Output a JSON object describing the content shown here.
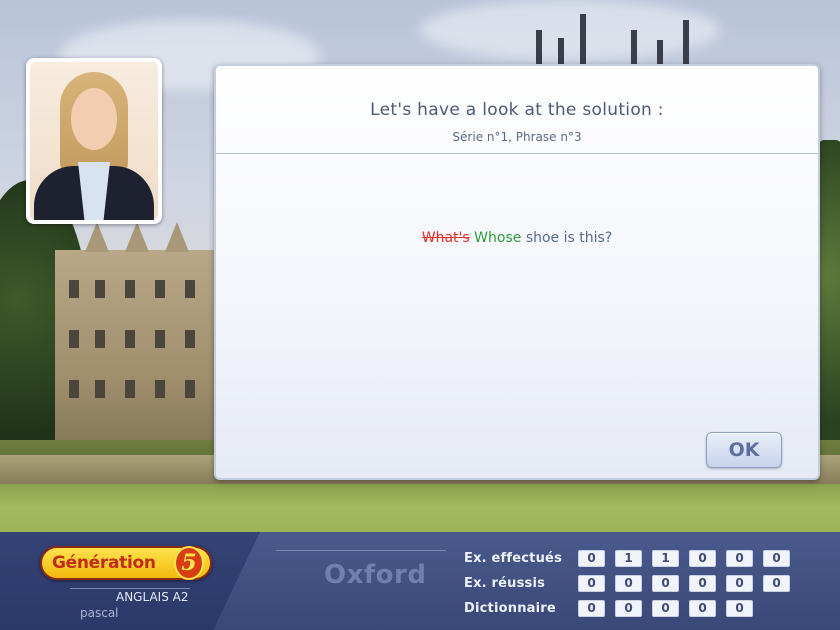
{
  "dialog": {
    "title": "Let's have a look at the solution :",
    "subtitle": "Série n°1, Phrase n°3",
    "sentence": {
      "wrong_word": "What's",
      "correct_word": "Whose",
      "rest": "shoe is this?"
    },
    "ok_label": "OK"
  },
  "brand": {
    "logo_text": "Génération",
    "logo_mark": "5",
    "course": "ANGLAIS A2",
    "user": "pascal",
    "city": "Oxford"
  },
  "stats": {
    "effectues": {
      "label": "Ex. effectués",
      "digits": [
        "0",
        "1",
        "1",
        "0",
        "0",
        "0"
      ]
    },
    "reussis": {
      "label": "Ex. réussis",
      "digits": [
        "0",
        "0",
        "0",
        "0",
        "0",
        "0"
      ]
    },
    "dictionnaire": {
      "label": "Dictionnaire",
      "digits": [
        "0",
        "0",
        "0",
        "0",
        "0"
      ]
    }
  },
  "colors": {
    "wrong": "#e0312b",
    "correct": "#2f9a3d",
    "bar": "#3a4878"
  }
}
